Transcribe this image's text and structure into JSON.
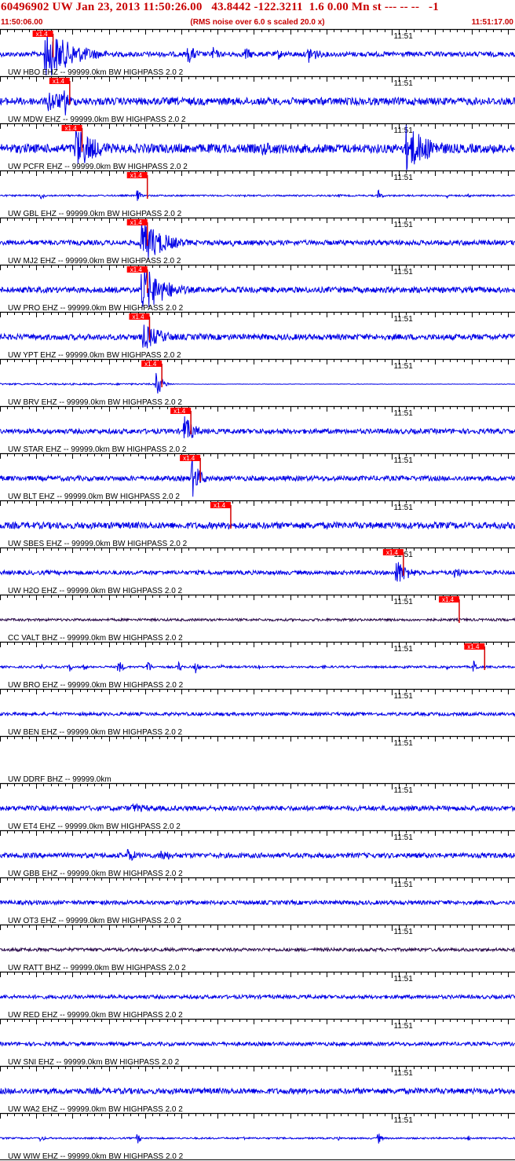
{
  "header": {
    "title": "60496902 UW Jan 23, 2013 11:50:26.00   43.8442 -122.3211  1.6 0.00 Mn st --- -- --   -1",
    "start_time": "11:50:06.00",
    "note": "(RMS noise over 6.0 s scaled 20.0 x)",
    "end_time": "11:51:17.00"
  },
  "colors": {
    "trace": "#0000e6",
    "trace_dark": "#2a0a4a",
    "pick_box": "#ff0000",
    "pick_line": "#d40000",
    "header_text": "#c80000",
    "separator": "#000000"
  },
  "chart_data": {
    "type": "seismogram",
    "x_range_seconds": [
      0,
      71
    ],
    "minute_mark": {
      "label": "11:51",
      "seconds": 54
    },
    "pick_label": "x1.4",
    "traces": [
      {
        "label": "UW HBO EHZ -- 99999.0km BW  HIGHPASS  2.0  2",
        "pick": 4.5,
        "noise": 0.12,
        "events": [
          {
            "t": 6.1,
            "amp": 1.35,
            "dur": 9
          },
          {
            "t": 25.8,
            "amp": 0.55,
            "dur": 3
          },
          {
            "t": 29.2,
            "amp": 0.45,
            "dur": 2
          },
          {
            "t": 33.6,
            "amp": 0.4,
            "dur": 3
          },
          {
            "t": 38.2,
            "amp": 0.35,
            "dur": 2
          },
          {
            "t": 42.4,
            "amp": 0.6,
            "dur": 3
          }
        ]
      },
      {
        "label": "UW MDW EHZ -- 99999.0km BW  HIGHPASS  2.0  2",
        "pick": 6.8,
        "noise": 0.18,
        "events": [
          {
            "t": 6.5,
            "amp": 0.6,
            "dur": 8
          },
          {
            "t": 8.8,
            "amp": 1.2,
            "dur": 1
          }
        ]
      },
      {
        "label": "UW PCFR EHZ -- 99999.0km BW  HIGHPASS  2.0  2",
        "pick": 8.5,
        "noise": 0.22,
        "events": [
          {
            "t": 10.3,
            "amp": 1.15,
            "dur": 7
          },
          {
            "t": 36,
            "amp": 0.35,
            "dur": 18
          },
          {
            "t": 55.8,
            "amp": 1.25,
            "dur": 8
          }
        ]
      },
      {
        "label": "UW GBL EHZ -- 99999.0km BW  HIGHPASS  2.0  2",
        "pick": 17.5,
        "noise": 0.04,
        "events": [
          {
            "t": 5.5,
            "amp": 0.3,
            "dur": 1
          },
          {
            "t": 18.8,
            "amp": 0.45,
            "dur": 1
          },
          {
            "t": 33.5,
            "amp": 0.2,
            "dur": 0.5
          },
          {
            "t": 46.5,
            "amp": 0.3,
            "dur": 0.6
          },
          {
            "t": 52,
            "amp": 0.45,
            "dur": 1
          },
          {
            "t": 61.5,
            "amp": 0.25,
            "dur": 0.6
          },
          {
            "t": 64.5,
            "amp": 0.3,
            "dur": 0.6
          }
        ]
      },
      {
        "label": "UW MJ2 EHZ -- 99999.0km BW  HIGHPASS  2.0  2",
        "pick": 17.5,
        "noise": 0.12,
        "events": [
          {
            "t": 19.2,
            "amp": 1.3,
            "dur": 7
          },
          {
            "t": 32,
            "amp": 0.3,
            "dur": 0.6
          },
          {
            "t": 44.5,
            "amp": 0.25,
            "dur": 0.6
          }
        ]
      },
      {
        "label": "UW PRO EHZ -- 99999.0km BW  HIGHPASS  2.0  2",
        "pick": 17.5,
        "noise": 0.14,
        "events": [
          {
            "t": 19.4,
            "amp": 1.35,
            "dur": 7
          }
        ]
      },
      {
        "label": "UW YPT EHZ -- 99999.0km BW  HIGHPASS  2.0  2",
        "pick": 17.8,
        "noise": 0.14,
        "events": [
          {
            "t": 19.6,
            "amp": 0.7,
            "dur": 7
          },
          {
            "t": 27.5,
            "amp": 0.25,
            "dur": 2
          }
        ]
      },
      {
        "label": "UW BRV EHZ -- 99999.0km BW  HIGHPASS  2.0  2",
        "pick": 19.5,
        "noise": 0.04,
        "events": [
          {
            "t": 21.4,
            "amp": 1.0,
            "dur": 1.6
          }
        ],
        "flat_after": 23.2
      },
      {
        "label": "UW STAR EHZ -- 99999.0km BW  HIGHPASS  2.0  2",
        "pick": 23.5,
        "noise": 0.12,
        "events": [
          {
            "t": 25.3,
            "amp": 0.9,
            "dur": 3
          },
          {
            "t": 56.8,
            "amp": 0.25,
            "dur": 0.8
          }
        ]
      },
      {
        "label": "UW BLT EHZ -- 99999.0km BW  HIGHPASS  2.0  2",
        "pick": 24.8,
        "noise": 0.12,
        "events": [
          {
            "t": 26.3,
            "amp": 1.2,
            "dur": 2.5
          }
        ]
      },
      {
        "label": "UW SBES EHZ -- 99999.0km BW  HIGHPASS  2.0  2",
        "pick": 29.0,
        "noise": 0.16,
        "events": [
          {
            "t": 31.3,
            "amp": 0.3,
            "dur": 3
          }
        ]
      },
      {
        "label": "UW H2O EHZ -- 99999.0km BW  HIGHPASS  2.0  2",
        "pick": 52.8,
        "noise": 0.1,
        "events": [
          {
            "t": 54.5,
            "amp": 0.75,
            "dur": 4
          },
          {
            "t": 62.5,
            "amp": 0.35,
            "dur": 3
          }
        ]
      },
      {
        "label": "CC VALT BHZ -- 99999.0km BW  HIGHPASS  2.0  2",
        "pick": 60.5,
        "noise": 0.06,
        "dark": true,
        "events": []
      },
      {
        "label": "UW BRO EHZ -- 99999.0km BW  HIGHPASS  2.0  2",
        "pick": 64.0,
        "noise": 0.05,
        "events": [
          {
            "t": 5.5,
            "amp": 0.3,
            "dur": 1
          },
          {
            "t": 9.5,
            "amp": 0.35,
            "dur": 1
          },
          {
            "t": 11.5,
            "amp": 0.25,
            "dur": 1
          },
          {
            "t": 16.2,
            "amp": 0.45,
            "dur": 1.5
          },
          {
            "t": 20.2,
            "amp": 0.6,
            "dur": 1
          },
          {
            "t": 24.5,
            "amp": 0.45,
            "dur": 1
          },
          {
            "t": 26.8,
            "amp": 0.5,
            "dur": 1
          },
          {
            "t": 30.5,
            "amp": 0.2,
            "dur": 0.6
          },
          {
            "t": 35.5,
            "amp": 0.3,
            "dur": 1
          },
          {
            "t": 44.5,
            "amp": 0.25,
            "dur": 0.6
          },
          {
            "t": 55.5,
            "amp": 0.3,
            "dur": 0.8
          },
          {
            "t": 61.5,
            "amp": 0.25,
            "dur": 0.6
          },
          {
            "t": 65.2,
            "amp": 0.55,
            "dur": 1
          }
        ]
      },
      {
        "label": "UW BEN EHZ -- 99999.0km BW  HIGHPASS  2.0  2",
        "pick": null,
        "noise": 0.08,
        "events": []
      },
      {
        "label": "UW DDRF BHZ -- 99999.0km",
        "pick": null,
        "noise": 0,
        "events": []
      },
      {
        "label": "UW ET4 EHZ -- 99999.0km BW  HIGHPASS  2.0  2",
        "pick": null,
        "noise": 0.12,
        "events": [
          {
            "t": 18,
            "amp": 0.25,
            "dur": 10
          }
        ]
      },
      {
        "label": "UW GBB EHZ -- 99999.0km BW  HIGHPASS  2.0  2",
        "pick": null,
        "noise": 0.12,
        "events": [
          {
            "t": 17.5,
            "amp": 0.45,
            "dur": 3
          },
          {
            "t": 22,
            "amp": 0.4,
            "dur": 4
          }
        ]
      },
      {
        "label": "UW OT3 EHZ -- 99999.0km BW  HIGHPASS  2.0  2",
        "pick": null,
        "noise": 0.1,
        "events": []
      },
      {
        "label": "UW RATT BHZ -- 99999.0km BW  HIGHPASS  2.0  2",
        "pick": null,
        "noise": 0.08,
        "dark": true,
        "events": []
      },
      {
        "label": "UW RED EHZ -- 99999.0km BW  HIGHPASS  2.0  2",
        "pick": null,
        "noise": 0.09,
        "events": []
      },
      {
        "label": "UW SNI EHZ -- 99999.0km BW  HIGHPASS  2.0  2",
        "pick": null,
        "noise": 0.09,
        "events": []
      },
      {
        "label": "UW WA2 EHZ -- 99999.0km BW  HIGHPASS  2.0  2",
        "pick": null,
        "noise": 0.14,
        "events": []
      },
      {
        "label": "UW WIW EHZ -- 99999.0km BW  HIGHPASS  2.0  2",
        "pick": null,
        "noise": 0.04,
        "events": [
          {
            "t": 5.5,
            "amp": 0.3,
            "dur": 1
          },
          {
            "t": 18.8,
            "amp": 0.45,
            "dur": 1
          },
          {
            "t": 33.5,
            "amp": 0.2,
            "dur": 0.5
          },
          {
            "t": 46.5,
            "amp": 0.25,
            "dur": 0.6
          },
          {
            "t": 52,
            "amp": 0.45,
            "dur": 1
          },
          {
            "t": 64.5,
            "amp": 0.3,
            "dur": 0.6
          }
        ]
      }
    ]
  }
}
